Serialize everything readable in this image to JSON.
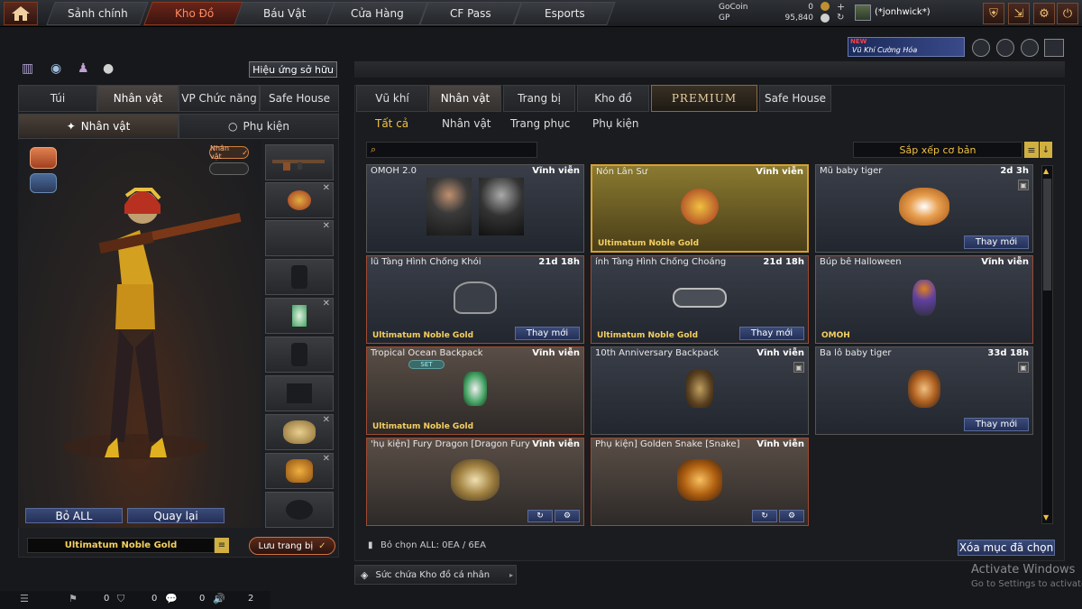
{
  "nav": {
    "tabs": [
      {
        "label": "Sảnh chính"
      },
      {
        "label": "Kho Đồ"
      },
      {
        "label": "Báu Vật"
      },
      {
        "label": "Cửa Hàng"
      },
      {
        "label": "CF Pass"
      },
      {
        "label": "Esports"
      }
    ],
    "gocoin_label": "GoCoin",
    "gocoin_value": "0",
    "gp_label": "GP",
    "gp_value": "95,840",
    "username": "(*jonhwick*)"
  },
  "banner": {
    "new_badge": "NEW",
    "text": "Vũ Khí Cường Hóa"
  },
  "left": {
    "effects_button": "Hiệu ứng sở hữu",
    "tabs": [
      {
        "label": "Túi"
      },
      {
        "label": "Nhân vật"
      },
      {
        "label": "VP Chức năng"
      },
      {
        "label": "Safe House"
      }
    ],
    "subtabs": [
      {
        "label": "Nhân vật"
      },
      {
        "label": "Phụ kiện"
      }
    ],
    "char_badge": "Nhân vật",
    "remove_all": "Bỏ ALL",
    "back": "Quay lại",
    "preset_name": "Ultimatum Noble Gold",
    "save_button": "Lưu trang bị"
  },
  "right": {
    "tabs": [
      {
        "label": "Vũ khí"
      },
      {
        "label": "Nhân vật"
      },
      {
        "label": "Trang bị"
      },
      {
        "label": "Kho đồ"
      },
      {
        "label": "PREMIUM"
      },
      {
        "label": "Safe House"
      }
    ],
    "subtabs": [
      {
        "label": "Tất cả"
      },
      {
        "label": "Nhân vật"
      },
      {
        "label": "Trang phục"
      },
      {
        "label": "Phụ kiện"
      }
    ],
    "search_placeholder": "",
    "sort_label": "Sắp xếp cơ bản",
    "items": [
      {
        "name": "OMOH 2.0",
        "duration": "Vĩnh viễn",
        "tag": "",
        "renew": ""
      },
      {
        "name": "Nón Lân Sư",
        "duration": "Vĩnh viễn",
        "tag": "Ultimatum Noble Gold",
        "renew": ""
      },
      {
        "name": "Mũ baby tiger",
        "duration": "2d 3h",
        "tag": "",
        "renew": "Thay mới"
      },
      {
        "name": "lũ Tàng Hình Chống Khói",
        "duration": "21d 18h",
        "tag": "Ultimatum Noble Gold",
        "renew": "Thay mới"
      },
      {
        "name": "ính Tàng Hình Chống Choáng",
        "duration": "21d 18h",
        "tag": "Ultimatum Noble Gold",
        "renew": "Thay mới"
      },
      {
        "name": "Búp bê Halloween",
        "duration": "Vĩnh viễn",
        "tag": "OMOH",
        "renew": ""
      },
      {
        "name": "Tropical Ocean Backpack",
        "duration": "Vĩnh viễn",
        "tag": "Ultimatum Noble Gold",
        "renew": "",
        "set": "SET"
      },
      {
        "name": "10th Anniversary Backpack",
        "duration": "Vĩnh viễn",
        "tag": "",
        "renew": ""
      },
      {
        "name": "Ba lô baby tiger",
        "duration": "33d 18h",
        "tag": "",
        "renew": "Thay mới"
      },
      {
        "name": "'hụ kiện] Fury Dragon [Dragon Fury",
        "duration": "Vĩnh viễn",
        "tag": "",
        "renew": ""
      },
      {
        "name": "Phụ kiện] Golden Snake [Snake]",
        "duration": "Vĩnh viễn",
        "tag": "",
        "renew": ""
      }
    ],
    "select_all": "Bỏ chọn ALL: 0EA / 6EA",
    "delete_button": "Xóa mục đã chọn",
    "capacity": "Sức chứa Kho đồ cá nhân"
  },
  "statusbar": {
    "c1": "0",
    "c2": "0",
    "c3": "0",
    "c4": "2"
  },
  "watermark": {
    "line1": "Activate Windows",
    "line2": "Go to Settings to activate"
  }
}
